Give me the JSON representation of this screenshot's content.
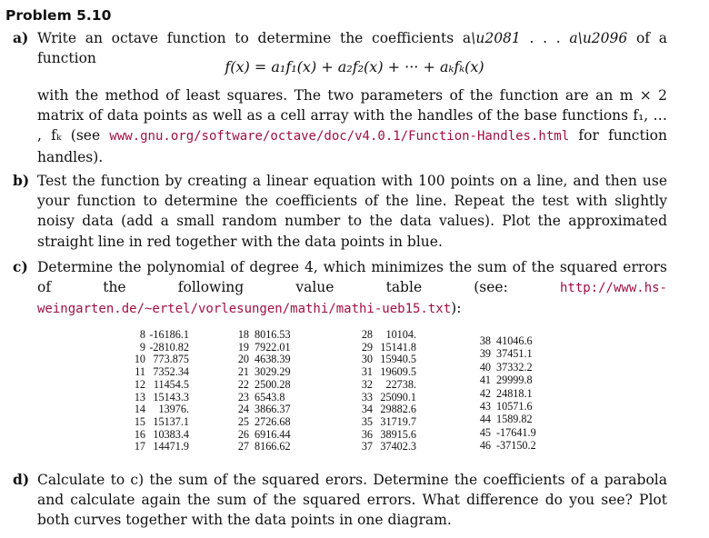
{
  "title": "Problem 5.10",
  "a": {
    "label": "a)",
    "line1": "Write an octave function to determine the coefficients a",
    "line1b": "of a function",
    "equation": "f(x) = a₁f₁(x) + a₂f₂(x) + ··· + aₖfₖ(x)",
    "text1": "with the method of least squares. The two parameters of the function are an m × 2 matrix of data points as well as a cell array with the handles of the base functions f₁, … , fₖ (see ",
    "url": "www.gnu.org/software/octave/doc/v4.0.1/Function-Handles.html",
    "text2": " for function handles)."
  },
  "b": {
    "label": "b)",
    "text": "Test the function by creating a linear equation with 100 points on a line, and then use your function to determine the coefficients of the line. Repeat the test with slightly noisy data (add a small random number to the data values). Plot the approximated straight line in red together with the data points in blue."
  },
  "c": {
    "label": "c)",
    "text": "Determine the polynomial of degree 4, which minimizes the sum of the squared errors of the following value table (see: ",
    "url": "http://www.hs-weingarten.de/~ertel/vorlesungen/mathi/mathi-ueb15.txt",
    "text2": "):"
  },
  "table": [
    [
      [
        "8",
        "-16186.1"
      ],
      [
        "9",
        "-2810.82"
      ],
      [
        "10",
        "773.875"
      ],
      [
        "11",
        "7352.34"
      ],
      [
        "12",
        "11454.5"
      ],
      [
        "13",
        "15143.3"
      ],
      [
        "14",
        "13976."
      ],
      [
        "15",
        "15137.1"
      ],
      [
        "16",
        "10383.4"
      ],
      [
        "17",
        "14471.9"
      ]
    ],
    [
      [
        "18",
        "8016.53"
      ],
      [
        "19",
        "7922.01"
      ],
      [
        "20",
        "4638.39"
      ],
      [
        "21",
        "3029.29"
      ],
      [
        "22",
        "2500.28"
      ],
      [
        "23",
        "6543.8"
      ],
      [
        "24",
        "3866.37"
      ],
      [
        "25",
        "2726.68"
      ],
      [
        "26",
        "6916.44"
      ],
      [
        "27",
        "8166.62"
      ]
    ],
    [
      [
        "28",
        "10104."
      ],
      [
        "29",
        "15141.8"
      ],
      [
        "30",
        "15940.5"
      ],
      [
        "31",
        "19609.5"
      ],
      [
        "32",
        "22738."
      ],
      [
        "33",
        "25090.1"
      ],
      [
        "34",
        "29882.6"
      ],
      [
        "35",
        "31719.7"
      ],
      [
        "36",
        "38915.6"
      ],
      [
        "37",
        "37402.3"
      ]
    ],
    [
      [
        "38",
        "41046.6"
      ],
      [
        "39",
        "37451.1"
      ],
      [
        "40",
        "37332.2"
      ],
      [
        "41",
        "29999.8"
      ],
      [
        "42",
        "24818.1"
      ],
      [
        "43",
        "10571.6"
      ],
      [
        "44",
        "1589.82"
      ],
      [
        "45",
        "-17641.9"
      ],
      [
        "46",
        "-37150.2"
      ]
    ]
  ],
  "d": {
    "label": "d)",
    "text": "Calculate to c) the sum of the squared erors. Determine the coefficients of a parabola and calculate again the sum of the squared errors. What difference do you see? Plot both curves together with the data points in one diagram."
  }
}
